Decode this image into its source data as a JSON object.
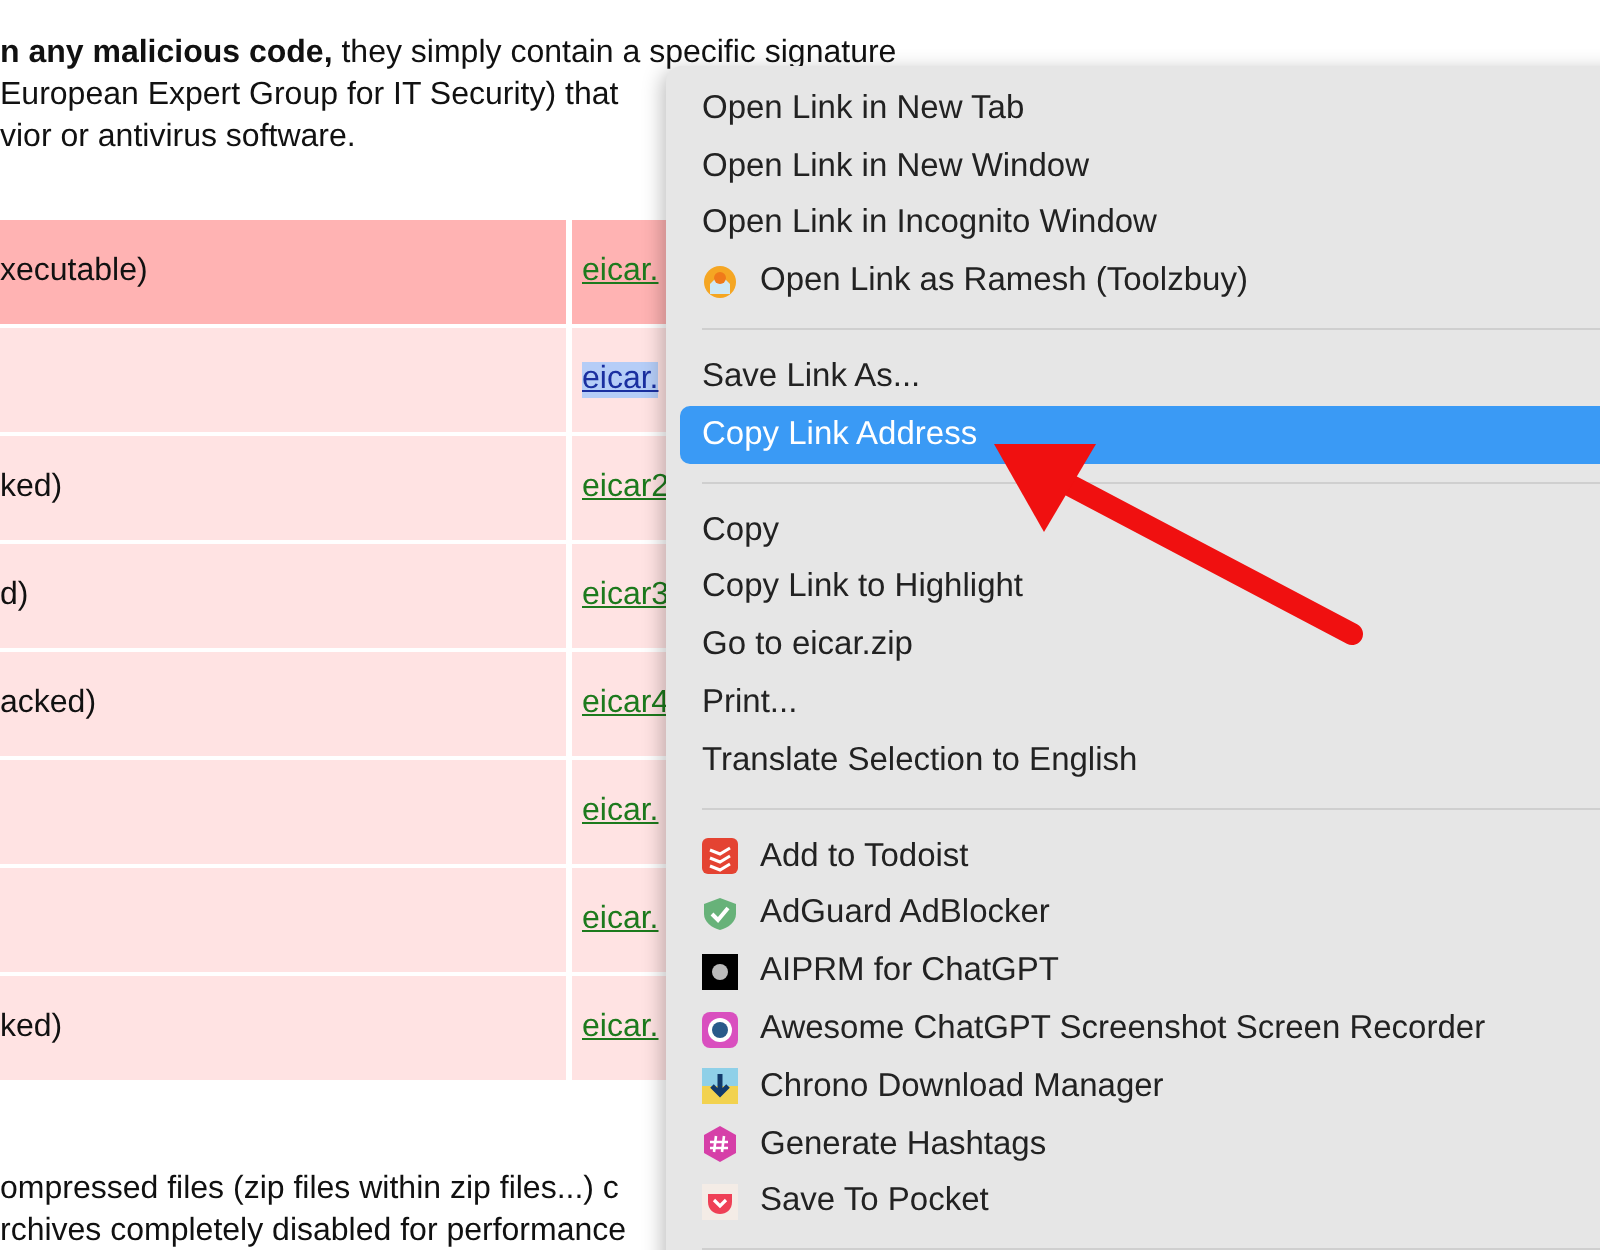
{
  "article": {
    "paragraph_lines": [
      "**n any malicious code,** they simply contain a specific signature",
      "European Expert Group for IT Security) that",
      "vior or antivirus software."
    ],
    "table": {
      "rows": [
        {
          "column_1": "xecutable)",
          "column_2": "eicar.",
          "header": true,
          "selected": false
        },
        {
          "column_1": "",
          "column_2": "eicar.",
          "header": false,
          "selected": true
        },
        {
          "column_1": "ked)",
          "column_2": "eicar2",
          "header": false,
          "selected": false
        },
        {
          "column_1": "d)",
          "column_2": "eicar3",
          "header": false,
          "selected": false
        },
        {
          "column_1": "acked)",
          "column_2": "eicar4",
          "header": false,
          "selected": false
        },
        {
          "column_1": "",
          "column_2": "eicar.",
          "header": false,
          "selected": false
        },
        {
          "column_1": "",
          "column_2": "eicar.",
          "header": false,
          "selected": false
        },
        {
          "column_1": "ked)",
          "column_2": "eicar.",
          "header": false,
          "selected": false
        }
      ]
    },
    "after_lines": [
      "ompressed files (zip files  within zip files...) c",
      "rchives completely disabled for performance"
    ]
  },
  "context_menu": {
    "items": [
      {
        "kind": "item",
        "label": "Open Link in New Tab",
        "selected": false
      },
      {
        "kind": "item",
        "label": "Open Link in New Window",
        "selected": false
      },
      {
        "kind": "item",
        "label": "Open Link in Incognito Window",
        "selected": false
      },
      {
        "kind": "icon_item",
        "label": "Open Link as Ramesh (Toolzbuy)",
        "selected": false
      },
      {
        "kind": "separator"
      },
      {
        "kind": "item",
        "label": "Save Link As...",
        "selected": false
      },
      {
        "kind": "item",
        "label": "Copy Link Address",
        "selected": true
      },
      {
        "kind": "separator"
      },
      {
        "kind": "item",
        "label": "Copy",
        "selected": false
      },
      {
        "kind": "item",
        "label": "Copy Link to Highlight",
        "selected": false
      },
      {
        "kind": "item",
        "label": "Go to eicar.zip",
        "selected": false
      },
      {
        "kind": "item",
        "label": "Print...",
        "selected": false
      },
      {
        "kind": "item",
        "label": "Translate Selection to English",
        "selected": false
      },
      {
        "kind": "separator"
      },
      {
        "kind": "icon_item",
        "label": "Add to Todoist",
        "selected": false
      },
      {
        "kind": "icon_item",
        "label": "AdGuard AdBlocker",
        "selected": false
      },
      {
        "kind": "icon_item",
        "label": "AIPRM for ChatGPT",
        "selected": false
      },
      {
        "kind": "icon_item",
        "label": "Awesome ChatGPT Screenshot  Screen Recorder",
        "selected": false
      },
      {
        "kind": "icon_item",
        "label": "Chrono Download Manager",
        "selected": false
      },
      {
        "kind": "icon_item",
        "label": "Generate Hashtags",
        "selected": false
      },
      {
        "kind": "icon_item",
        "label": "Save To Pocket",
        "selected": false
      },
      {
        "kind": "separator"
      }
    ]
  },
  "annotation": {
    "arrow": true
  }
}
